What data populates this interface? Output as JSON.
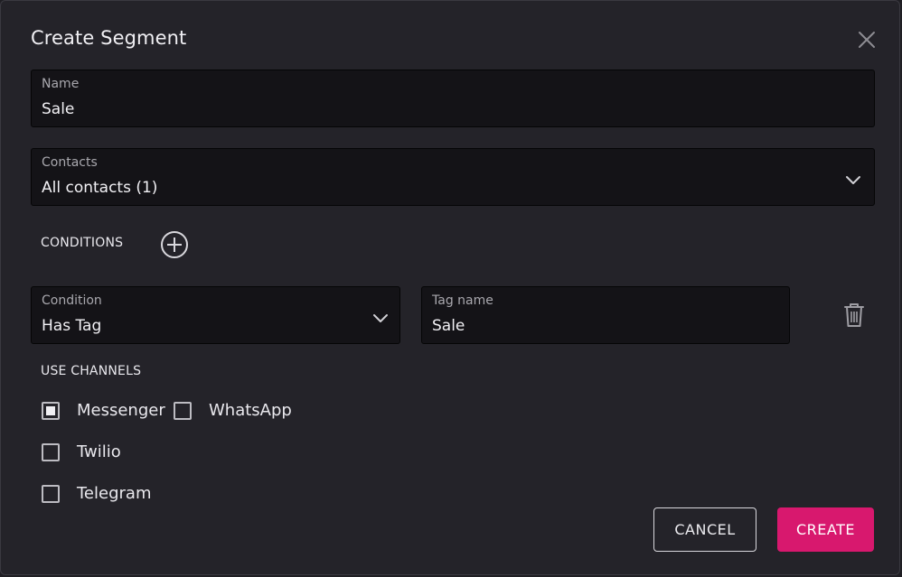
{
  "dialog": {
    "title": "Create Segment"
  },
  "name_field": {
    "label": "Name",
    "value": "Sale"
  },
  "contacts_field": {
    "label": "Contacts",
    "value": "All contacts (1)"
  },
  "conditions": {
    "label": "CONDITIONS",
    "items": [
      {
        "condition_label": "Condition",
        "condition_value": "Has Tag",
        "tag_label": "Tag name",
        "tag_value": "Sale"
      }
    ]
  },
  "channels": {
    "label": "USE CHANNELS",
    "items": [
      {
        "label": "Messenger",
        "checked": true
      },
      {
        "label": "WhatsApp",
        "checked": false
      },
      {
        "label": "Twilio",
        "checked": false
      },
      {
        "label": "Telegram",
        "checked": false
      }
    ]
  },
  "actions": {
    "cancel_label": "CANCEL",
    "create_label": "CREATE"
  },
  "colors": {
    "accent": "#d8186e",
    "background": "#242329",
    "field": "#141317"
  },
  "icons": {
    "close": "close-icon",
    "chevron": "chevron-down-icon",
    "add": "plus-circle-icon",
    "delete": "trash-icon"
  }
}
